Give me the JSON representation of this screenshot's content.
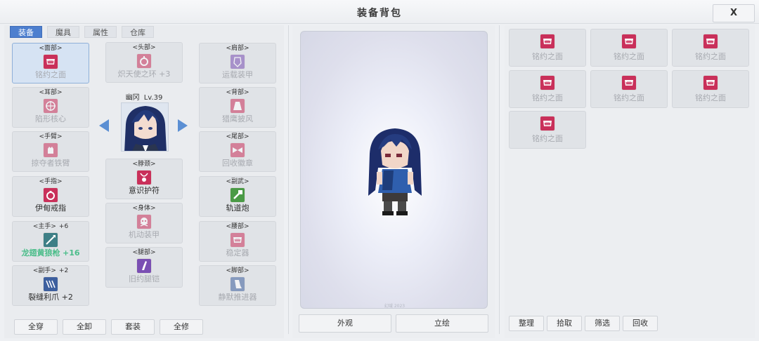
{
  "window": {
    "title": "装备背包",
    "close_label": "X"
  },
  "tabs": [
    "装备",
    "魔具",
    "属性",
    "仓库"
  ],
  "character": {
    "name": "幽冈",
    "level": "Lv.39"
  },
  "slots": [
    {
      "category": "<面部>",
      "name": "铭约之面",
      "icon": "mask-fangs-icon"
    },
    {
      "category": "<耳部>",
      "name": "陷形核心",
      "icon": "target-core-icon"
    },
    {
      "category": "<手臂>",
      "name": "掠夺者铁臂",
      "icon": "gauntlet-icon"
    },
    {
      "category": "<手指>",
      "name": "伊甸戒指",
      "icon": "ring-icon"
    },
    {
      "category": "<主手>",
      "level": "+6",
      "name": "龙翅黄狼枪",
      "enhance": "+16",
      "icon": "spear-icon"
    },
    {
      "category": "<副手>",
      "level": "+2",
      "name": "裂缝利爪",
      "enhance": "+2",
      "icon": "claw-icon"
    },
    {
      "category": "<头部>",
      "name": "炽天使之环 +3",
      "icon": "halo-icon"
    },
    {
      "category": "<脖颈>",
      "name": "意识护符",
      "icon": "amulet-icon"
    },
    {
      "category": "<身体>",
      "name": "机动装甲",
      "icon": "skull-armor-icon"
    },
    {
      "category": "<腿部>",
      "name": "旧约腿铠",
      "icon": "leg-armor-icon"
    },
    {
      "category": "<肩部>",
      "name": "运载装甲",
      "icon": "shoulder-armor-icon"
    },
    {
      "category": "<背部>",
      "name": "猎鹰披风",
      "icon": "cape-icon"
    },
    {
      "category": "<尾部>",
      "name": "回收徽章",
      "icon": "bow-badge-icon"
    },
    {
      "category": "<副武>",
      "name": "轨道炮",
      "icon": "rail-gun-icon"
    },
    {
      "category": "<腰部>",
      "name": "稳定器",
      "icon": "stabilizer-icon"
    },
    {
      "category": "<脚部>",
      "name": "静默推进器",
      "icon": "thruster-icon"
    }
  ],
  "equip_buttons": [
    "全穿",
    "全卸",
    "套装",
    "全修"
  ],
  "preview_buttons": [
    "外观",
    "立绘"
  ],
  "preview_watermark": "幻域 2023",
  "inventory": {
    "items": [
      "铭约之面",
      "铭约之面",
      "铭约之面",
      "铭约之面",
      "铭约之面",
      "铭约之面",
      "铭约之面"
    ],
    "buttons": [
      "整理",
      "拾取",
      "筛选",
      "回收"
    ]
  },
  "colors": {
    "accent": "#4d7fcf",
    "enhance_green": "#4bbd8a",
    "item_red": "#c9305a"
  }
}
